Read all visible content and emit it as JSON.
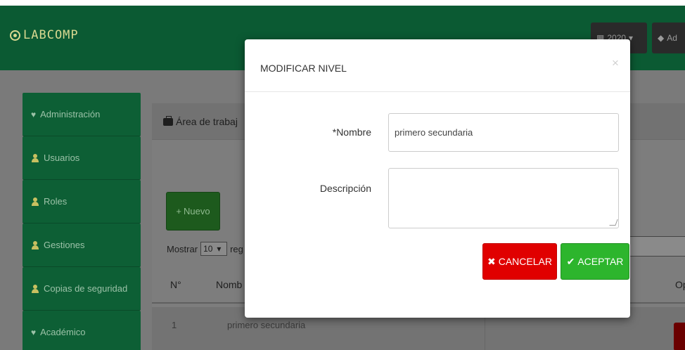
{
  "navbar": {
    "brand": "LABCOMP",
    "year_button": "2020",
    "admin_button": "Ad"
  },
  "sidebar": {
    "items": [
      {
        "label": "Administración",
        "icon": "heart-icon"
      },
      {
        "label": "Usuarios",
        "icon": "user-icon"
      },
      {
        "label": "Roles",
        "icon": "user-icon"
      },
      {
        "label": "Gestiones",
        "icon": "user-icon"
      },
      {
        "label": "Copias de seguridad",
        "icon": "user-icon"
      },
      {
        "label": "Académico",
        "icon": "heart-icon"
      }
    ]
  },
  "panel": {
    "title": "Área de trabaj",
    "new_button": "Nuevo",
    "show_label": "Mostrar",
    "show_value": "10",
    "show_suffix": "reg",
    "table": {
      "headers": [
        "N°",
        "Nomb",
        "Op"
      ],
      "rows": [
        {
          "n": "1",
          "name": "primero secundaria"
        }
      ]
    }
  },
  "modal": {
    "title": "MODIFICAR NIVEL",
    "close": "×",
    "name_label": "*Nombre",
    "name_value": "primero secundaria",
    "desc_label": "Descripción",
    "desc_value": "",
    "cancel_button": "CANCELAR",
    "accept_button": "ACEPTAR"
  },
  "colors": {
    "navbar": "#0b5a33",
    "cancel": "#e00000",
    "accept": "#2db52d"
  }
}
